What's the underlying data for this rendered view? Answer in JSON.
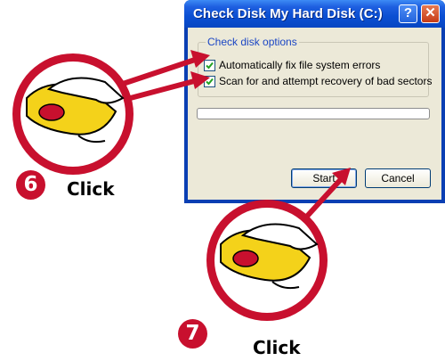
{
  "dialog": {
    "title": "Check Disk My Hard Disk (C:)",
    "help_button": "?",
    "close_button": "✕",
    "group_label": "Check disk options",
    "options": [
      {
        "label": "Automatically fix file system errors",
        "checked": true
      },
      {
        "label": "Scan for and attempt recovery of bad sectors",
        "checked": true
      }
    ],
    "progress": 0,
    "start_label": "Start",
    "cancel_label": "Cancel"
  },
  "steps": [
    {
      "number": "6",
      "label": "Click"
    },
    {
      "number": "7",
      "label": "Click"
    }
  ],
  "colors": {
    "callout_red": "#c8102e",
    "mouse_yellow": "#f4d21a",
    "title_blue": "#0a4fd2"
  }
}
